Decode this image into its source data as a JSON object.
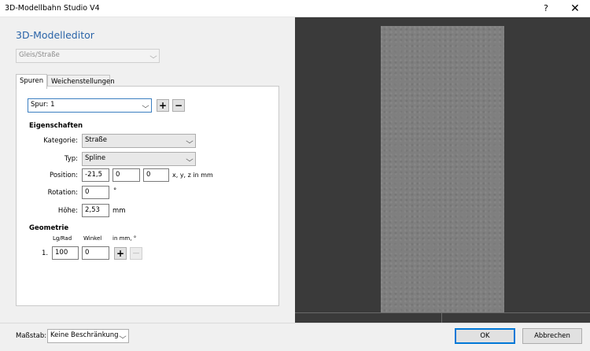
{
  "window": {
    "title": "3D-Modellbahn Studio V4",
    "help_label": "?",
    "close_label": "✕"
  },
  "editor": {
    "heading": "3D-Modelleditor",
    "type_select": {
      "value": "Gleis/Straße",
      "disabled": true
    },
    "tabs": [
      {
        "label": "Spuren",
        "active": true
      },
      {
        "label": "Weichenstellungen",
        "active": false
      }
    ],
    "track_select": {
      "value": "Spur: 1"
    },
    "add_track_label": "+",
    "remove_track_label": "−",
    "properties": {
      "heading": "Eigenschaften",
      "category_label": "Kategorie:",
      "category_value": "Straße",
      "type_label": "Typ:",
      "type_value": "Spline",
      "position_label": "Position:",
      "position_x": "-21,5",
      "position_y": "0",
      "position_z": "0",
      "position_unit": "x, y, z in mm",
      "rotation_label": "Rotation:",
      "rotation_value": "0",
      "rotation_unit": "°",
      "height_label": "Höhe:",
      "height_value": "2,53",
      "height_unit": "mm"
    },
    "geometry": {
      "heading": "Geometrie",
      "col_length": "Lg/Rad",
      "col_angle": "Winkel",
      "col_unit": "in mm, °",
      "rows": [
        {
          "index": "1.",
          "length": "100",
          "angle": "0"
        }
      ],
      "add_label": "+",
      "remove_label": "—"
    }
  },
  "footer": {
    "scale_label": "Maßstab:",
    "scale_value": "Keine Beschränkung",
    "ok_label": "OK",
    "cancel_label": "Abbrechen"
  },
  "colors": {
    "accent": "#2a64a8",
    "viewport_bg": "#3a3a3a",
    "road_surface": "#7f7f7f",
    "default_button_border": "#0078d7"
  }
}
